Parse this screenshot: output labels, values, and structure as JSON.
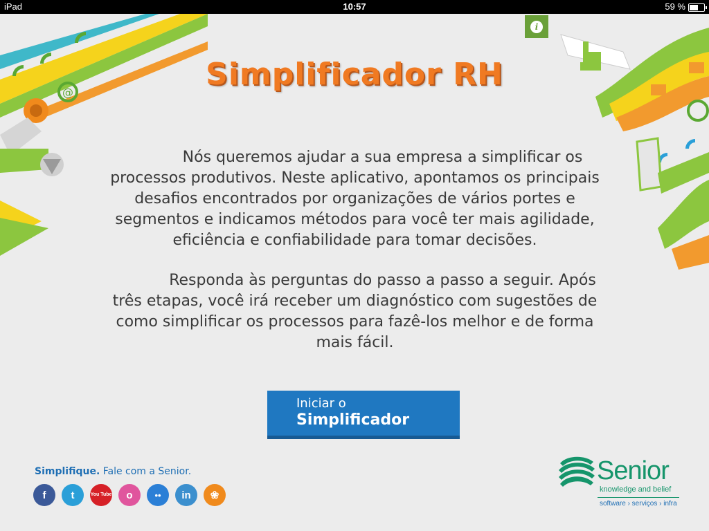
{
  "status_bar": {
    "device": "iPad",
    "time": "10:57",
    "battery": "59 %",
    "battery_level": 0.59
  },
  "info_button": {
    "label": "i"
  },
  "title": "Simplificador RH",
  "intro": {
    "paragraph1": "Nós queremos ajudar a sua empresa a simplificar os processos produtivos. Neste aplicativo, apontamos os principais desafios encontrados por organizações de vários portes e segmentos e indicamos métodos para você ter mais agilidade, eficiência e confiabilidade para tomar decisões.",
    "paragraph2": "Responda às perguntas do passo a passo a seguir. Após três etapas, você irá receber um diagnóstico com sugestões de como simplificar os processos para fazê-los melhor e de forma mais fácil."
  },
  "start_button": {
    "line1": "Iniciar o",
    "line2": "Simplificador"
  },
  "footer": {
    "tagline_bold": "Simplifique.",
    "tagline_rest": " Fale com a Senior.",
    "socials": [
      {
        "name": "facebook",
        "glyph": "f",
        "color": "#3b5998"
      },
      {
        "name": "twitter",
        "glyph": "t",
        "color": "#2a9fd8"
      },
      {
        "name": "youtube",
        "glyph": "You Tube",
        "color": "#d62027"
      },
      {
        "name": "orkut",
        "glyph": "o",
        "color": "#e0559d"
      },
      {
        "name": "flickr",
        "glyph": "••",
        "color": "#2b7fd6"
      },
      {
        "name": "linkedin",
        "glyph": "in",
        "color": "#3b8fce"
      },
      {
        "name": "slideshare",
        "glyph": "❀",
        "color": "#f08a1c"
      }
    ]
  },
  "brand": {
    "name": "Senior",
    "tagline": "knowledge and belief",
    "services": "software › serviços › infra",
    "color": "#16956b"
  },
  "colors": {
    "accent_orange": "#f07a22",
    "button_blue": "#1f78c1",
    "text_gray": "#3a3a3a",
    "deco_green": "#8cc63f",
    "deco_yellow": "#f5d31c"
  }
}
